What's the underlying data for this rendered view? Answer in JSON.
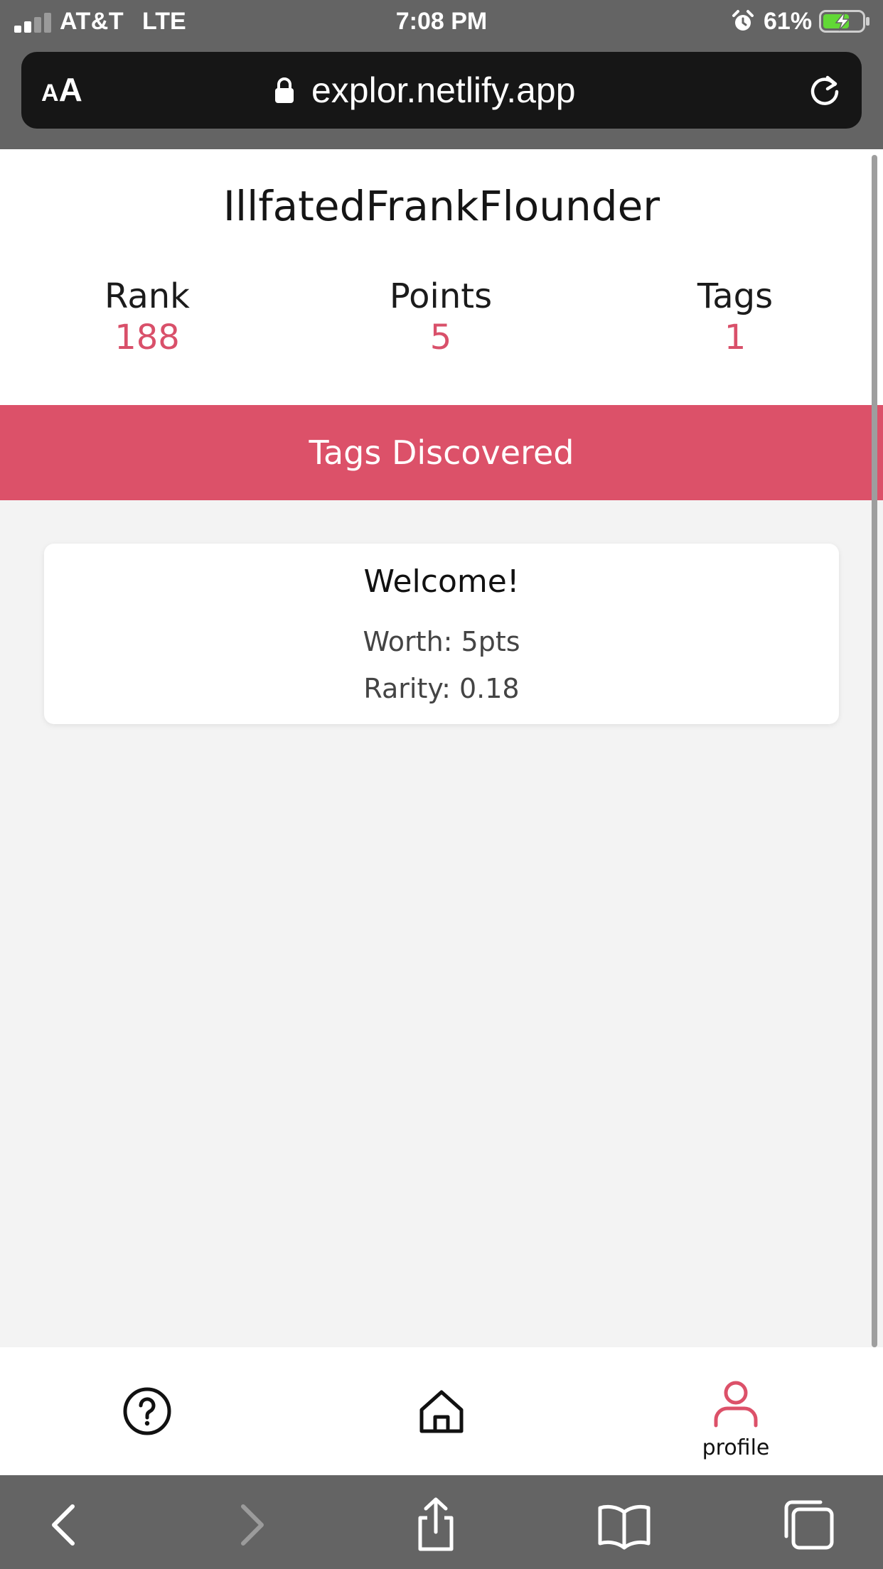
{
  "status_bar": {
    "carrier": "AT&T",
    "network": "LTE",
    "time": "7:08 PM",
    "battery_percent": "61%",
    "icons": [
      "signal-icon",
      "alarm-icon",
      "battery-charging-icon"
    ]
  },
  "browser": {
    "text_size_small": "A",
    "text_size_big": "A",
    "url": "explor.netlify.app",
    "icons": [
      "lock-icon",
      "reload-icon"
    ],
    "toolbar": [
      "back-icon",
      "forward-icon",
      "share-icon",
      "bookmarks-icon",
      "tabs-icon"
    ]
  },
  "profile": {
    "username": "IllfatedFrankFlounder",
    "stats": [
      {
        "label": "Rank",
        "value": "188"
      },
      {
        "label": "Points",
        "value": "5"
      },
      {
        "label": "Tags",
        "value": "1"
      }
    ]
  },
  "section": {
    "title": "Tags Discovered"
  },
  "tags": [
    {
      "name": "Welcome!",
      "worth": "Worth: 5pts",
      "rarity": "Rarity: 0.18"
    }
  ],
  "nav": {
    "items": [
      {
        "icon": "help-icon",
        "label": ""
      },
      {
        "icon": "home-icon",
        "label": ""
      },
      {
        "icon": "profile-icon",
        "label": "profile"
      }
    ],
    "active": "profile"
  },
  "colors": {
    "accent": "#dc5169",
    "stat_value": "#d9506a",
    "browser_chrome": "#646464",
    "address_bar": "#161616",
    "page_background": "#f3f3f3"
  }
}
